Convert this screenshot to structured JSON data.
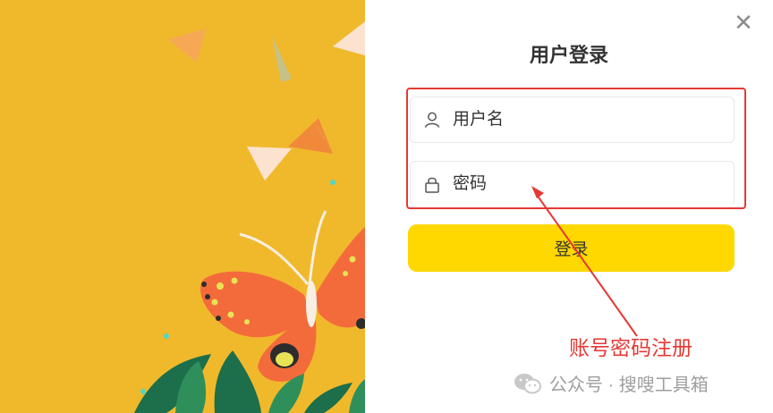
{
  "dialog": {
    "title": "用户登录",
    "close_glyph": "✕",
    "close_icon": "close-icon"
  },
  "form": {
    "username_placeholder": "用户名",
    "username_icon": "user-icon",
    "password_placeholder": "密码",
    "password_icon": "lock-icon",
    "login_label": "登录"
  },
  "annotation": {
    "text": "账号密码注册",
    "color": "#e53935"
  },
  "watermark": {
    "text": "公众号 · 搜嗖工具箱",
    "icon": "wechat-icon"
  },
  "colors": {
    "illustration_background": "#f0b92b",
    "login_button": "#ffd800",
    "title": "#333333"
  }
}
